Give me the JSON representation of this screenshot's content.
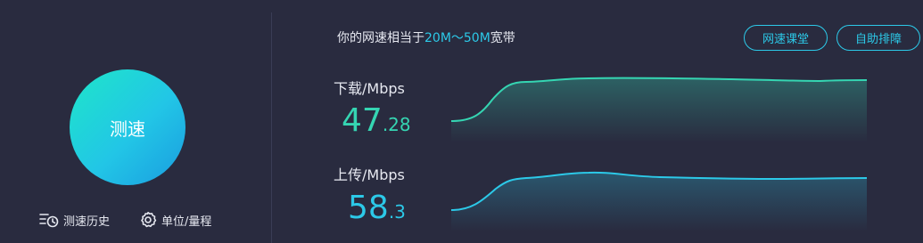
{
  "left": {
    "speed_button_label": "测速",
    "history_label": "测速历史",
    "unit_label": "单位/量程"
  },
  "headline": {
    "prefix": "你的网速相当于",
    "range": "20M～50M",
    "suffix": "宽带"
  },
  "buttons": {
    "course": "网速课堂",
    "self_help": "自助排障"
  },
  "download": {
    "label": "下载/Mbps",
    "value_int": "47",
    "value_dec": ".28",
    "speed": 47.28
  },
  "upload": {
    "label": "上传/Mbps",
    "value_int": "58",
    "value_dec": ".3",
    "speed": 58.3
  },
  "colors": {
    "background": "#292b3f",
    "download_accent": "#35d5b2",
    "upload_accent": "#2cc9e8"
  },
  "icons": {
    "history": "history-list-icon",
    "unit": "gear-icon"
  }
}
